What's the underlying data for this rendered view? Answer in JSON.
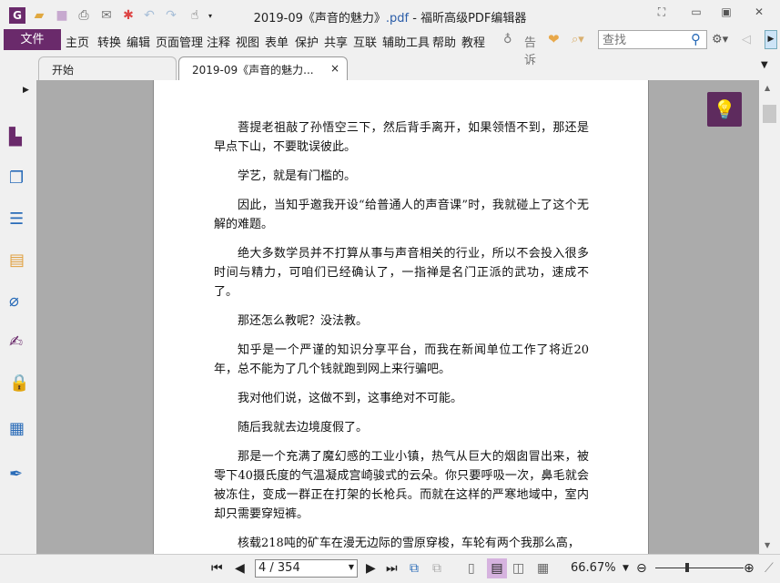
{
  "window": {
    "title_main": "2019-09《声音的魅力》",
    "title_ext": ".pdf",
    "title_app": " - 福昕高级PDF编辑器"
  },
  "menu": {
    "file": "文件",
    "items": [
      "主页",
      "转换",
      "编辑",
      "页面管理",
      "注释",
      "视图",
      "表单",
      "保护",
      "共享",
      "互联",
      "辅助工具",
      "帮助",
      "教程"
    ],
    "tell": "告诉"
  },
  "search": {
    "placeholder": "查找"
  },
  "tabs": [
    {
      "label": "开始"
    },
    {
      "label": "2019-09《声音的魅力...",
      "close": "×"
    }
  ],
  "document": {
    "paragraphs": [
      {
        "lines": [
          "菩提老祖敲了孙悟空三下，然后背手离开，如果领悟不到，那还是",
          "早点下山，不要耽误彼此。"
        ]
      },
      {
        "lines": [
          "学艺，就是有门槛的。"
        ]
      },
      {
        "lines": [
          "因此，当知乎邀我开设“给普通人的声音课”时，我就碰上了这个无",
          "解的难题。"
        ]
      },
      {
        "lines": [
          "绝大多数学员并不打算从事与声音相关的行业，所以不会投入很多",
          "时间与精力，可咱们已经确认了，一指禅是名门正派的武功，速成不",
          "了。"
        ]
      },
      {
        "lines": [
          "那还怎么教呢？没法教。"
        ]
      },
      {
        "lines": [
          "知乎是一个严谨的知识分享平台，而我在新闻单位工作了将近20",
          "年，总不能为了几个钱就跑到网上来行骗吧。"
        ]
      },
      {
        "lines": [
          "我对他们说，这做不到，这事绝对不可能。"
        ]
      },
      {
        "lines": [
          "随后我就去边境度假了。"
        ]
      },
      {
        "lines": [
          "那是一个充满了魔幻感的工业小镇，热气从巨大的烟囱冒出来，被",
          "零下40摄氏度的气温凝成宫崎骏式的云朵。你只要呼吸一次，鼻毛就会",
          "被冻住，变成一群正在打架的长枪兵。而就在这样的严寒地域中，室内",
          "却只需要穿短裤。"
        ]
      },
      {
        "lines": [
          "核载218吨的矿车在漫无边际的雪原穿梭，车轮有两个我那么高，"
        ]
      }
    ]
  },
  "status": {
    "page": "4 / 354",
    "zoom": "66.67%"
  },
  "colors": {
    "brand": "#6a2a6b",
    "page_bg": "#ababab"
  }
}
